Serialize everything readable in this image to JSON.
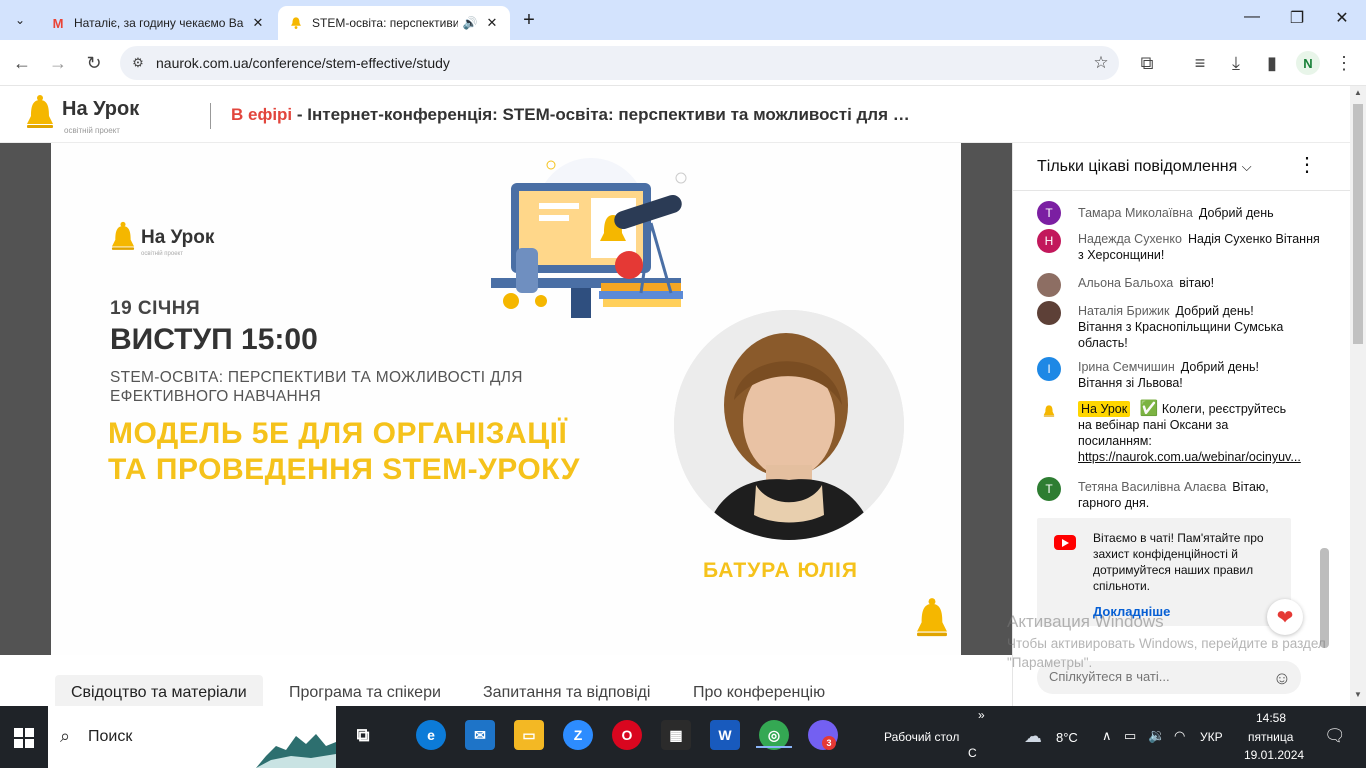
{
  "browser": {
    "tabs": [
      {
        "title": "Наталіє, за годину чекаємо Ва",
        "favicon": "gmail-icon"
      },
      {
        "title": "STEM-освіта: перспективи",
        "favicon": "naurok-bell-icon",
        "audio": true
      }
    ],
    "url": "naurok.com.ua/conference/stem-effective/study",
    "profile_initial": "N"
  },
  "site": {
    "logo_name": "На Урок",
    "logo_sub": "освітній проект",
    "live_label": "В ефірі",
    "live_title": " - Інтернет-конференція: STEM-освіта: перспективи та можливості для …"
  },
  "slide": {
    "logo_name": "На Урок",
    "logo_sub": "освітній проект",
    "date": "19 СІЧНЯ",
    "time": "ВИСТУП 15:00",
    "subtitle": "STEM-ОСВІТА: ПЕРСПЕКТИВИ ТА МОЖЛИВОСТІ ДЛЯ ЕФЕКТИВНОГО НАВЧАННЯ",
    "topic": "МОДЕЛЬ 5Е ДЛЯ ОРГАНІЗАЦІЇ ТА ПРОВЕДЕННЯ STEM-УРОКУ",
    "speaker": "БАТУРА ЮЛІЯ"
  },
  "content_tabs": [
    "Свідоцтво та матеріали",
    "Програма та спікери",
    "Запитання та відповіді",
    "Про конференцію"
  ],
  "chat": {
    "mode": "Тільки цікаві повідомлення",
    "messages": [
      {
        "initial": "Т",
        "color": "#7b1fa2",
        "author": "Тамара Миколаївна",
        "text": "Добрий день"
      },
      {
        "initial": "Н",
        "color": "#c2185b",
        "author": "Надежда Сухенко",
        "text": "Надія Сухенко Вітання з Херсонщини!"
      },
      {
        "initial": "",
        "color": "#8d6e63",
        "author": "Альона Бальоха",
        "text": "вітаю!"
      },
      {
        "initial": "",
        "color": "#5d4037",
        "author": "Наталія Брижик",
        "text": "Добрий день! Вітання з Краснопільщини Сумська область!"
      },
      {
        "initial": "І",
        "color": "#1e88e5",
        "author": "Ірина Семчишин",
        "text": "Добрий день! Вітання зі Львова!"
      },
      {
        "initial": "",
        "color": "#f5b700",
        "author": "На Урок",
        "text": "Колеги, реєструйтесь на вебінар пані Оксани за посиланням:",
        "link": "https://naurok.com.ua/webinar/ocinyuv...",
        "check": "✅"
      },
      {
        "initial": "Т",
        "color": "#2e7d32",
        "author": "Тетяна Василівна Алаєва",
        "text": "Вітаю, гарного дня."
      }
    ],
    "notice": "Вітаємо в чаті! Пам'ятайте про захист конфіденційності й дотримуйтеся наших правил спільноти.",
    "notice_more": "Докладніше",
    "input_placeholder": "Спілкуйтеся в чаті..."
  },
  "activation": {
    "title": "Активация Windows",
    "text": "Чтобы активировать Windows, перейдите в раздел \"Параметры\"."
  },
  "taskbar": {
    "search": "Поиск",
    "desktop": "Рабочий стол",
    "weather": "8°C",
    "lang": "УКР",
    "time": "14:58",
    "weekday": "пятница",
    "date": "19.01.2024",
    "viber_badge": "3",
    "chevron": "»",
    "desktop_c": "С"
  }
}
